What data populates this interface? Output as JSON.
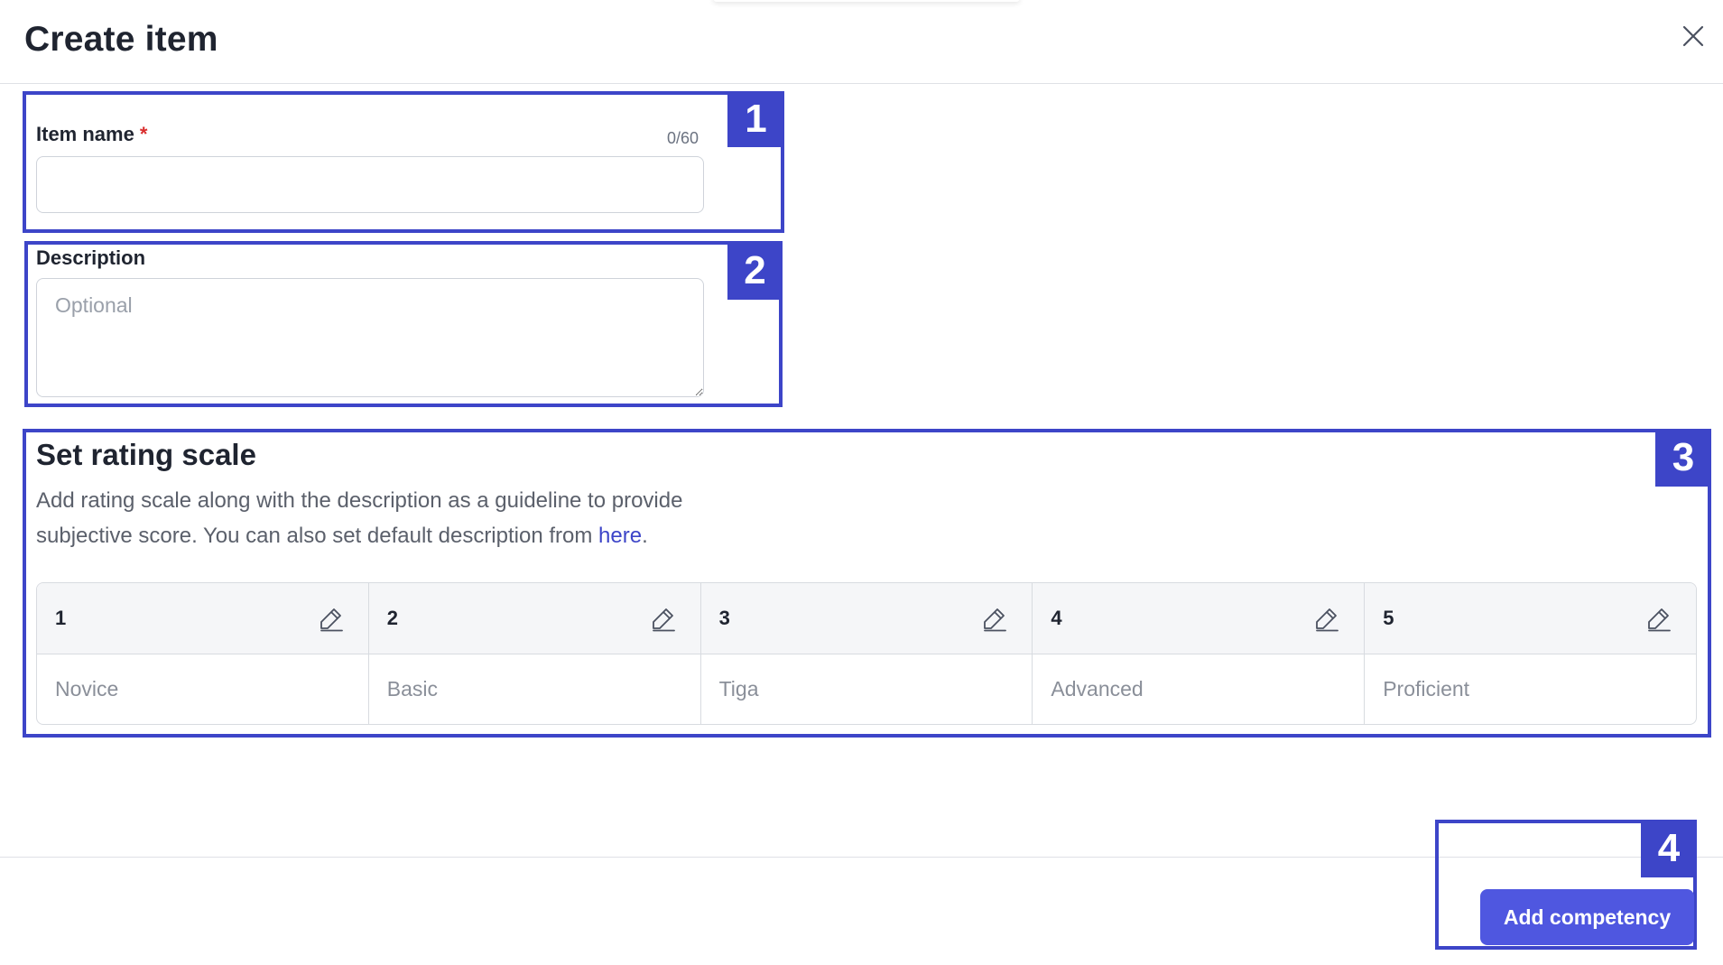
{
  "header": {
    "title": "Create item"
  },
  "item_name": {
    "label": "Item name",
    "required_mark": "*",
    "counter": "0/60",
    "value": ""
  },
  "description": {
    "label": "Description",
    "placeholder": "Optional"
  },
  "rating_scale": {
    "title": "Set rating scale",
    "description_text": "Add rating scale along with the description as a guideline to provide subjective score. You can also set default description from ",
    "link_text": "here",
    "description_end": ".",
    "levels": [
      {
        "number": "1",
        "placeholder": "Novice"
      },
      {
        "number": "2",
        "placeholder": "Basic"
      },
      {
        "number": "3",
        "placeholder": "Tiga"
      },
      {
        "number": "4",
        "placeholder": "Advanced"
      },
      {
        "number": "5",
        "placeholder": "Proficient"
      }
    ]
  },
  "footer": {
    "primary_button": "Add competency"
  },
  "annotations": [
    "1",
    "2",
    "3",
    "4"
  ],
  "colors": {
    "annotation": "#3d45c8",
    "primary": "#4f57e0",
    "required": "#d92d2d",
    "link": "#3d45c8"
  }
}
